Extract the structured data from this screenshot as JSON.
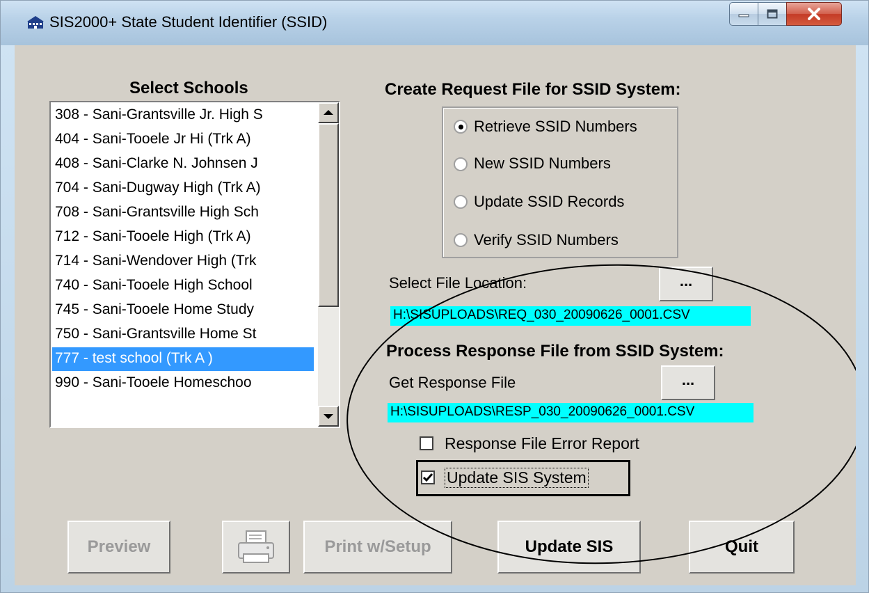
{
  "window": {
    "title": "SIS2000+ State Student Identifier (SSID)"
  },
  "schools": {
    "heading": "Select Schools",
    "items": [
      "308 - Sani-Grantsville Jr. High S",
      "404 - Sani-Tooele Jr Hi (Trk A)",
      "408 - Sani-Clarke N. Johnsen J",
      "704 - Sani-Dugway High (Trk A)",
      "708 - Sani-Grantsville High Sch",
      "712 - Sani-Tooele High (Trk A)",
      "714 - Sani-Wendover High (Trk",
      "740 - Sani-Tooele High School",
      "745 - Sani-Tooele Home Study",
      "750 - Sani-Grantsville Home St",
      "777 - test school (Trk A )",
      "990 - Sani-Tooele Homeschoo"
    ],
    "selected_index": 10
  },
  "request": {
    "heading": "Create Request File for SSID System:",
    "options": [
      "Retrieve SSID Numbers",
      "New SSID Numbers",
      "Update SSID Records",
      "Verify SSID Numbers"
    ],
    "selected": "Retrieve SSID Numbers",
    "file_location_label": "Select File Location:",
    "browse_label": "...",
    "file_path": "H:\\SISUPLOADS\\REQ_030_20090626_0001.CSV"
  },
  "response": {
    "heading": "Process Response File from SSID System:",
    "get_file_label": "Get Response File",
    "browse_label": "...",
    "file_path": "H:\\SISUPLOADS\\RESP_030_20090626_0001.CSV",
    "error_report_label": "Response File Error Report",
    "error_report_checked": false,
    "update_sis_label": "Update SIS System",
    "update_sis_checked": true
  },
  "buttons": {
    "preview": "Preview",
    "print_setup": "Print w/Setup",
    "update_sis": "Update SIS",
    "quit": "Quit"
  },
  "colors": {
    "selection": "#3399ff",
    "path_highlight": "#00ffff",
    "face": "#d4d0c8"
  }
}
